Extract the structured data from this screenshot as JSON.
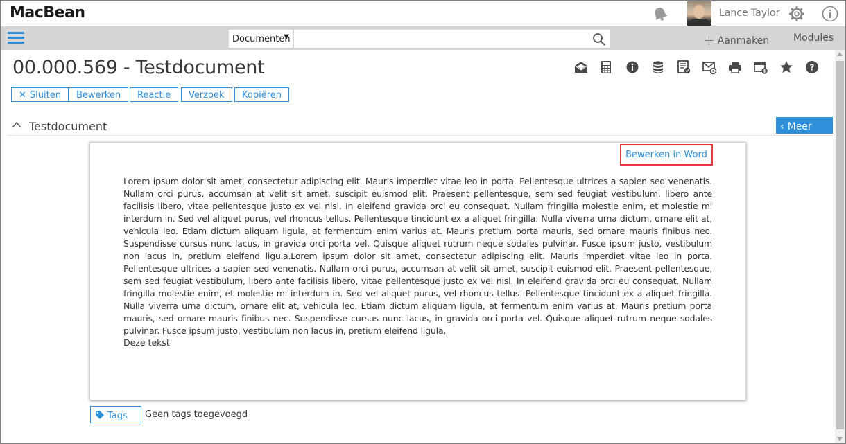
{
  "app": {
    "logo": "MacBean"
  },
  "header": {
    "user_name": "Lance Taylor",
    "icons": [
      "bell-icon",
      "avatar",
      "gear-icon",
      "info-icon"
    ]
  },
  "toolbar": {
    "search_type": "Documenten",
    "search_placeholder": "",
    "create_label": "Aanmaken",
    "modules_label": "Modules",
    "accent_color": "#2f8fd8"
  },
  "page": {
    "title": "00.000.569 - Testdocument",
    "action_icons": [
      "mail-open-icon",
      "calculator-icon",
      "info-circle-icon",
      "database-icon",
      "checklist-icon",
      "mail-settings-icon",
      "print-icon",
      "card-add-icon",
      "star-icon",
      "help-circle-icon"
    ],
    "buttons": {
      "close": "Sluiten",
      "edit": "Bewerken",
      "reply": "Reactie",
      "request": "Verzoek",
      "copy": "Kopiëren"
    }
  },
  "section": {
    "title": "Testdocument",
    "more_label": "Meer"
  },
  "document": {
    "edit_in_word": "Bewerken in Word",
    "body": "Lorem ipsum dolor sit amet, consectetur adipiscing elit. Mauris imperdiet vitae leo in porta. Pellentesque ultrices a sapien sed venenatis. Nullam orci purus, accumsan at velit sit amet, suscipit euismod elit. Praesent pellentesque, sem sed feugiat vestibulum, libero ante facilisis libero, vitae pellentesque justo ex vel nisl. In eleifend gravida orci eu consequat. Nullam fringilla molestie enim, et molestie mi interdum in. Sed vel aliquet purus, vel rhoncus tellus. Pellentesque tincidunt ex a aliquet fringilla. Nulla viverra urna dictum, ornare elit at, vehicula leo. Etiam dictum aliquam ligula, at fermentum enim varius at. Mauris pretium porta mauris, sed ornare mauris finibus nec. Suspendisse cursus nunc lacus, in gravida orci porta vel. Quisque aliquet rutrum neque sodales pulvinar. Fusce ipsum justo, vestibulum non lacus in, pretium eleifend ligula.Lorem ipsum dolor sit amet, consectetur adipiscing elit. Mauris imperdiet vitae leo in porta. Pellentesque ultrices a sapien sed venenatis. Nullam orci purus, accumsan at velit sit amet, suscipit euismod elit. Praesent pellentesque, sem sed feugiat vestibulum, libero ante facilisis libero, vitae pellentesque justo ex vel nisl. In eleifend gravida orci eu consequat. Nullam fringilla molestie enim, et molestie mi interdum in. Sed vel aliquet purus, vel rhoncus tellus. Pellentesque tincidunt ex a aliquet fringilla. Nulla viverra urna dictum, ornare elit at, vehicula leo. Etiam dictum aliquam ligula, at fermentum enim varius at. Mauris pretium porta mauris, sed ornare mauris finibus nec. Suspendisse cursus nunc lacus, in gravida orci porta vel. Quisque aliquet rutrum neque sodales pulvinar. Fusce ipsum justo, vestibulum non lacus in, pretium eleifend ligula.",
    "extra_line": "Deze tekst"
  },
  "tags": {
    "button_label": "Tags",
    "empty_text": "Geen tags toegevoegd"
  }
}
